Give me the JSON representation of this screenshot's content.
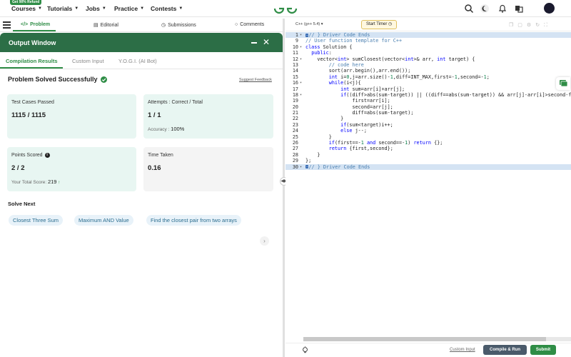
{
  "nav": {
    "promo": "Get 90% Refund",
    "items": [
      "Courses",
      "Tutorials",
      "Jobs",
      "Practice",
      "Contests"
    ]
  },
  "left_tabs": {
    "problem": "Problem",
    "editorial": "Editorial",
    "submissions": "Submissions",
    "comments": "Comments"
  },
  "output_window": {
    "title": "Output Window",
    "tabs": [
      "Compilation Results",
      "Custom Input",
      "Y.O.G.I. (AI Bot)"
    ],
    "status": "Problem Solved Successfully",
    "suggest_feedback": "Suggest Feedback",
    "cards": {
      "test_cases": {
        "label": "Test Cases Passed",
        "value": "1115 / 1115"
      },
      "attempts": {
        "label": "Attempts : Correct / Total",
        "value": "1 / 1",
        "sub_label": "Accuracy :",
        "sub_value": "100%"
      },
      "points": {
        "label": "Points Scored",
        "value": "2 / 2",
        "sub_label": "Your Total Score:",
        "sub_value": "219",
        "sub_arrow": "↑"
      },
      "time": {
        "label": "Time Taken",
        "value": "0.16"
      }
    },
    "solve_next": "Solve Next",
    "chips": [
      "Closest Three Sum",
      "Maximum AND Value",
      "Find the closest pair from two arrays"
    ]
  },
  "editor": {
    "language": "C++ (g++ 5.4)",
    "timer": "Start Timer",
    "custom_input": "Custom Input",
    "compile_run": "Compile & Run",
    "submit": "Submit",
    "code_lines": [
      {
        "n": "1",
        "fold": true,
        "hl": true,
        "html": "<span class=\"tag\">&#8943;</span><span class=\"cm\">// } Driver Code Ends</span>"
      },
      {
        "n": "9",
        "html": "<span class=\"cm\">// User function template for C++</span>"
      },
      {
        "n": "10",
        "fold": true,
        "html": "<span class=\"kw\">class</span> Solution {"
      },
      {
        "n": "11",
        "html": "  <span class=\"kw\">public</span>:"
      },
      {
        "n": "12",
        "fold": true,
        "html": "    vector&lt;<span class=\"kw\">int</span>&gt; sumClosest(vector&lt;<span class=\"kw\">int</span>&gt;&amp; arr, <span class=\"kw\">int</span> target) {"
      },
      {
        "n": "13",
        "html": "        <span class=\"cm\">// code here</span>"
      },
      {
        "n": "14",
        "html": "        sort(arr.begin(),arr.end());"
      },
      {
        "n": "15",
        "html": "        <span class=\"kw\">int</span> i=<span class=\"nm\">0</span>,j=arr.size()-<span class=\"nm\">1</span>,diff=INT_MAX,first=-<span class=\"nm\">1</span>,second=-<span class=\"nm\">1</span>;"
      },
      {
        "n": "16",
        "fold": true,
        "html": "        <span class=\"kw\">while</span>(i&lt;j){"
      },
      {
        "n": "17",
        "html": "            <span class=\"kw\">int</span> sum=arr[i]+arr[j];"
      },
      {
        "n": "18",
        "fold": true,
        "html": "            <span class=\"kw\">if</span>((diff&gt;abs(sum-target)) || ((diff==abs(sum-target)) &amp;&amp; arr[j]-arr[i]&gt;second-first)){"
      },
      {
        "n": "19",
        "html": "                first=arr[i];"
      },
      {
        "n": "20",
        "html": "                second=arr[j];"
      },
      {
        "n": "21",
        "html": "                diff=abs(sum-target);"
      },
      {
        "n": "22",
        "html": "            }"
      },
      {
        "n": "23",
        "html": "            <span class=\"kw\">if</span>(sum&lt;target)i++;"
      },
      {
        "n": "24",
        "html": "            <span class=\"kw\">else</span> j--;"
      },
      {
        "n": "25",
        "html": "        }"
      },
      {
        "n": "26",
        "html": "        <span class=\"kw\">if</span>(first==-<span class=\"nm\">1</span> <span class=\"kw\">and</span> second==-<span class=\"nm\">1</span>) <span class=\"kw\">return</span> {};"
      },
      {
        "n": "27",
        "html": "        <span class=\"kw\">return</span> {first,second};"
      },
      {
        "n": "28",
        "html": "    }"
      },
      {
        "n": "29",
        "html": "};"
      },
      {
        "n": "30",
        "fold": true,
        "hl": true,
        "html": "<span class=\"tag\">&#8943;</span><span class=\"cm\">// } Driver Code Ends</span>"
      }
    ]
  },
  "colors": {
    "brand_green": "#2f8d46",
    "header_green": "#2c6e46",
    "chip_text": "#2a6d8f"
  }
}
